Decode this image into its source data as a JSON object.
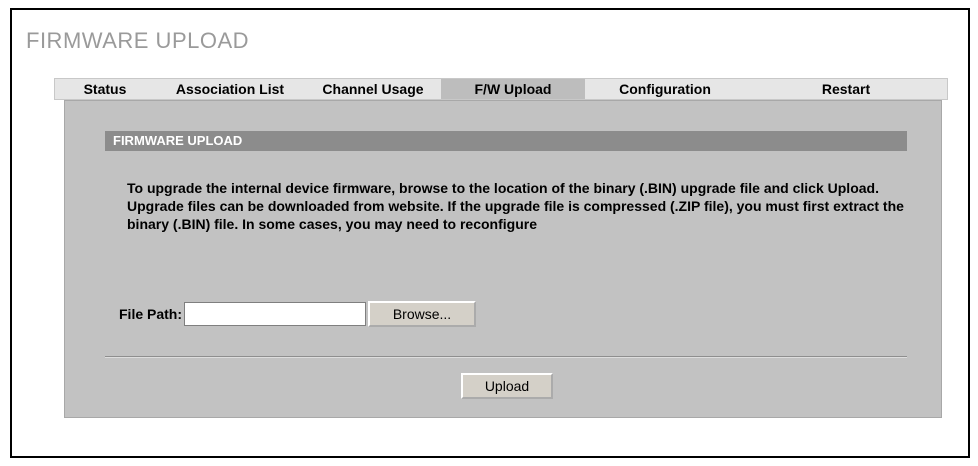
{
  "page": {
    "title": "FIRMWARE UPLOAD"
  },
  "tabs": [
    {
      "label": "Status",
      "active": false
    },
    {
      "label": "Association List",
      "active": false
    },
    {
      "label": "Channel Usage",
      "active": false
    },
    {
      "label": "F/W Upload",
      "active": true
    },
    {
      "label": "Configuration",
      "active": false
    },
    {
      "label": "Restart",
      "active": false
    }
  ],
  "section": {
    "header": "FIRMWARE UPLOAD",
    "description": "To upgrade the internal device firmware, browse to the location of the binary (.BIN) upgrade file and click Upload. Upgrade files can be downloaded from website. If the upgrade file is compressed (.ZIP file), you must first extract the binary (.BIN) file. In some cases, you may need to reconfigure"
  },
  "file": {
    "label": "File Path:",
    "value": "",
    "browse_label": "Browse..."
  },
  "actions": {
    "upload_label": "Upload"
  },
  "colors": {
    "panel": "#c2c2c2",
    "section_header": "#8c8c8c",
    "tab_active": "#bdbdbd",
    "title": "#9a9a9a"
  }
}
